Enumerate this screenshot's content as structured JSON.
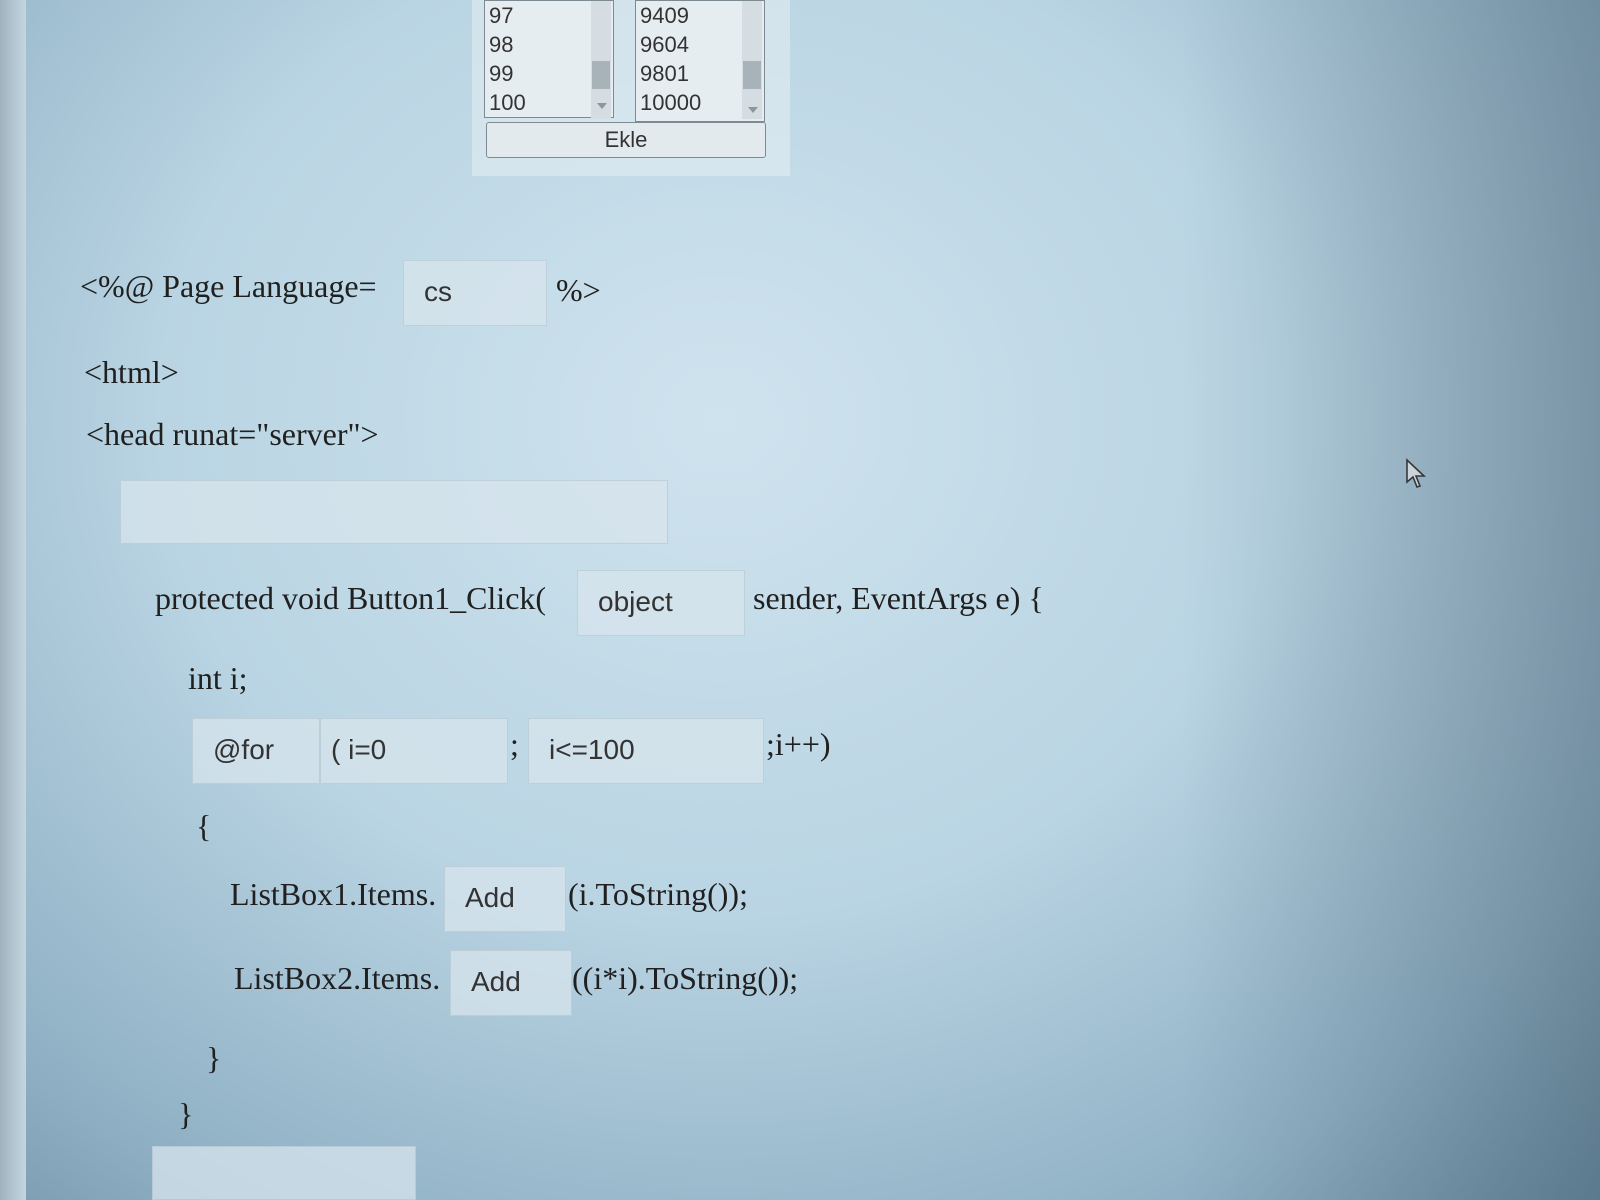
{
  "listbox1": {
    "items": [
      "97",
      "98",
      "99",
      "100"
    ]
  },
  "listbox2": {
    "items": [
      "9409",
      "9604",
      "9801",
      "10000"
    ]
  },
  "ekle_button": "Ekle",
  "code": {
    "page_prefix": "<%@ Page Language=",
    "page_suffix": "%>",
    "html_open": "<html>",
    "head_open": "<head runat=\"server\">",
    "method_prefix": "protected void Button1_Click(",
    "method_suffix": "sender, EventArgs e) {",
    "int_decl": "int i;",
    "semicolon": ";",
    "for_suffix": ";i++)",
    "open_brace": "{",
    "lb1_prefix": "ListBox1.Items.",
    "lb1_suffix": "(i.ToString());",
    "lb2_prefix": "ListBox2.Items.",
    "lb2_suffix": "((i*i).ToString());",
    "close_brace_inner": "}",
    "close_brace_outer": "}"
  },
  "fields": {
    "language": "cs",
    "script_tag": "",
    "param_type": "object",
    "loop_keyword": "@for",
    "loop_init": "( i=0",
    "loop_cond": "i<=100",
    "lb1_method": "Add",
    "lb2_method": "Add",
    "bottom_field": ""
  },
  "icons": {
    "cursor": "mouse-pointer-icon"
  }
}
